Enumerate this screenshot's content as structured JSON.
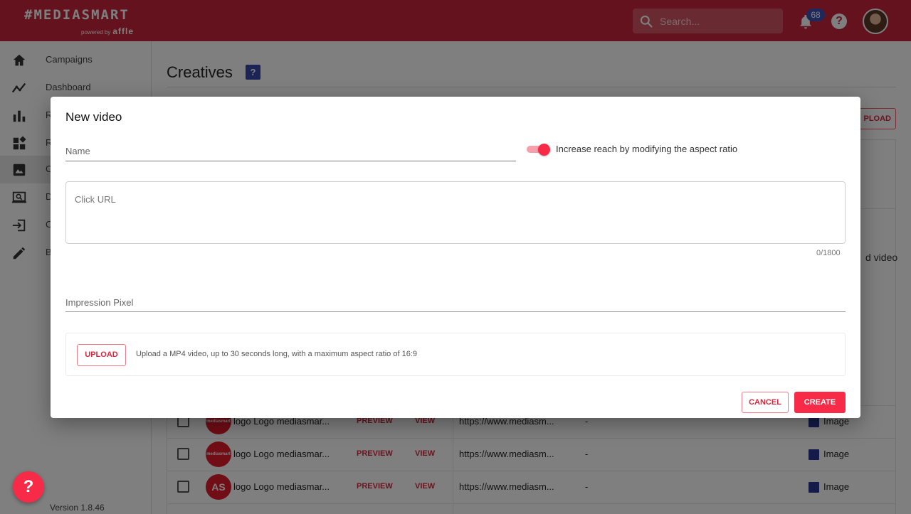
{
  "brand": {
    "logo_text": "#MEDIASMART",
    "powered_by": "powered by",
    "affle": "affle"
  },
  "search": {
    "placeholder": "Search..."
  },
  "notifications": {
    "count": "68"
  },
  "help": {
    "label": "?"
  },
  "sidebar": {
    "items": [
      {
        "label": "Campaigns",
        "icon": "home-icon"
      },
      {
        "label": "Dashboard",
        "icon": "trend-icon"
      },
      {
        "label": "R",
        "icon": "bar-chart-icon"
      },
      {
        "label": "R",
        "icon": "widgets-icon"
      },
      {
        "label": "C",
        "icon": "image-icon"
      },
      {
        "label": "D",
        "icon": "laptop-search-icon"
      },
      {
        "label": "C",
        "icon": "login-icon"
      },
      {
        "label": "B",
        "icon": "pencil-icon"
      }
    ],
    "version": "Version 1.8.46"
  },
  "main": {
    "title": "Creatives",
    "upload_label": "PLOAD",
    "partial_text": "d video",
    "rows": [
      {
        "thumb": "mediasmart",
        "name": "logo Logo mediasmar...",
        "preview": "PREVIEW",
        "view": "VIEW",
        "url": "https://www.mediasm...",
        "dash": "-",
        "type": "Image"
      },
      {
        "thumb": "mediasmart",
        "name": "logo Logo mediasmar...",
        "preview": "PREVIEW",
        "view": "VIEW",
        "url": "https://www.mediasm...",
        "dash": "-",
        "type": "Image"
      },
      {
        "thumb": "AS",
        "name": "logo Logo mediasmar...",
        "preview": "PREVIEW",
        "view": "VIEW",
        "url": "https://www.mediasm...",
        "dash": "-",
        "type": "Image"
      }
    ]
  },
  "modal": {
    "title": "New video",
    "name_label": "Name",
    "toggle_label": "Increase reach by modifying the aspect ratio",
    "toggle_on": true,
    "click_url_label": "Click URL",
    "counter": "0/1800",
    "impression_label": "Impression Pixel",
    "upload_button": "UPLOAD",
    "upload_hint": "Upload a MP4 video, up to 30 seconds long, with a maximum aspect ratio of 16:9",
    "cancel": "CANCEL",
    "create": "CREATE"
  },
  "colors": {
    "brand": "#c8243a",
    "accent": "#f72b48",
    "icon_blue": "#283593"
  }
}
